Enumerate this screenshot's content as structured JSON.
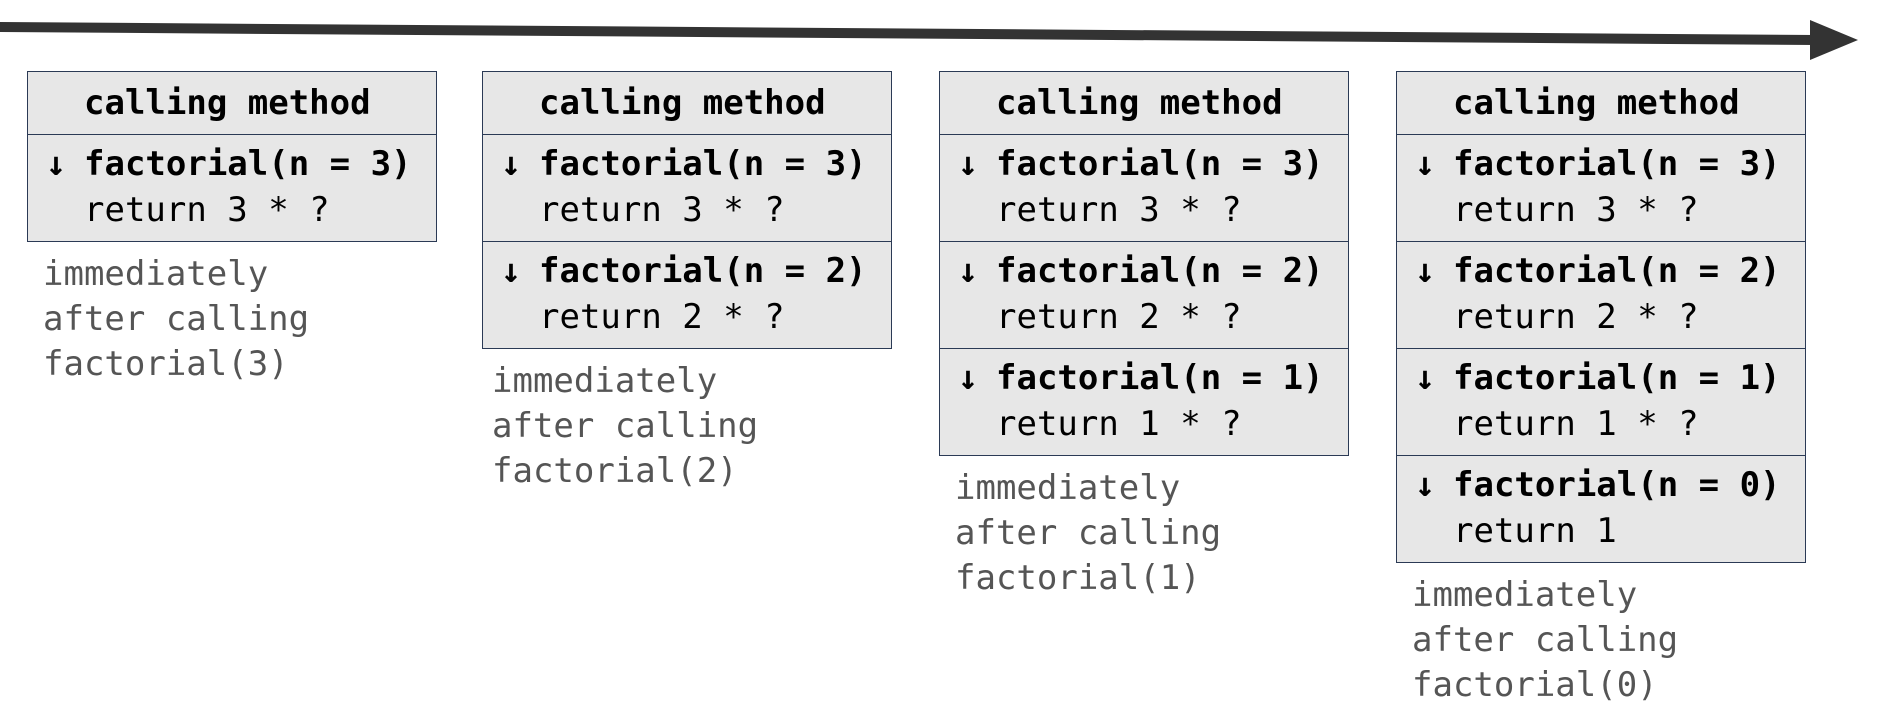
{
  "timeline": {
    "arrow_color": "#333333"
  },
  "colors": {
    "frame_fill": "#e7e7e7",
    "frame_border": "#2b3a55",
    "caption_text": "#555555"
  },
  "arrow_glyph": "↓",
  "columns": [
    {
      "header": "calling method",
      "frames": [
        {
          "call": "factorial(n = 3)",
          "ret": "return 3 * ?"
        }
      ],
      "caption": [
        "immediately",
        "after calling",
        "factorial(3)"
      ]
    },
    {
      "header": "calling method",
      "frames": [
        {
          "call": "factorial(n = 3)",
          "ret": "return 3 * ?"
        },
        {
          "call": "factorial(n = 2)",
          "ret": "return 2 * ?"
        }
      ],
      "caption": [
        "immediately",
        "after calling",
        "factorial(2)"
      ]
    },
    {
      "header": "calling method",
      "frames": [
        {
          "call": "factorial(n = 3)",
          "ret": "return 3 * ?"
        },
        {
          "call": "factorial(n = 2)",
          "ret": "return 2 * ?"
        },
        {
          "call": "factorial(n = 1)",
          "ret": "return 1 * ?"
        }
      ],
      "caption": [
        "immediately",
        "after calling",
        "factorial(1)"
      ]
    },
    {
      "header": "calling method",
      "frames": [
        {
          "call": "factorial(n = 3)",
          "ret": "return 3 * ?"
        },
        {
          "call": "factorial(n = 2)",
          "ret": "return 2 * ?"
        },
        {
          "call": "factorial(n = 1)",
          "ret": "return 1 * ?"
        },
        {
          "call": "factorial(n = 0)",
          "ret": "return 1"
        }
      ],
      "caption": [
        "immediately",
        "after calling",
        "factorial(0)"
      ]
    }
  ]
}
